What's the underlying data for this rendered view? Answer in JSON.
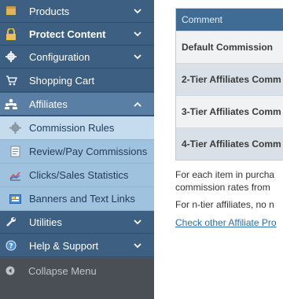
{
  "sidebar": {
    "items": [
      {
        "label": "Products",
        "icon": "box-icon"
      },
      {
        "label": "Protect Content",
        "icon": "lock-icon"
      },
      {
        "label": "Configuration",
        "icon": "gear-icon"
      },
      {
        "label": "Shopping Cart",
        "icon": "cart-icon"
      },
      {
        "label": "Affiliates",
        "icon": "people-icon"
      },
      {
        "label": "Utilities",
        "icon": "wrench-icon"
      },
      {
        "label": "Help & Support",
        "icon": "help-icon"
      }
    ],
    "subitems": [
      {
        "label": "Commission Rules",
        "icon": "gear-icon"
      },
      {
        "label": "Review/Pay Commissions",
        "icon": "document-icon"
      },
      {
        "label": "Clicks/Sales Statistics",
        "icon": "chart-icon"
      },
      {
        "label": "Banners and Text Links",
        "icon": "banner-icon"
      }
    ],
    "collapse_label": "Collapse Menu"
  },
  "main": {
    "table": {
      "header": "Comment",
      "rows": [
        "Default Commission",
        "2-Tier Affiliates Comm",
        "3-Tier Affiliates Comm",
        "4-Tier Affiliates Comm"
      ]
    },
    "para1_line1": "For each item in purcha",
    "para1_line2": "commission rates from",
    "para2": "For n-tier affiliates, no n",
    "link": "Check other Affiliate Pro"
  },
  "colors": {
    "sidebar_bg": "#3c5f82",
    "submenu_bg": "#9fc2df",
    "table_header": "#3f6c94",
    "link": "#2a6fb0"
  }
}
